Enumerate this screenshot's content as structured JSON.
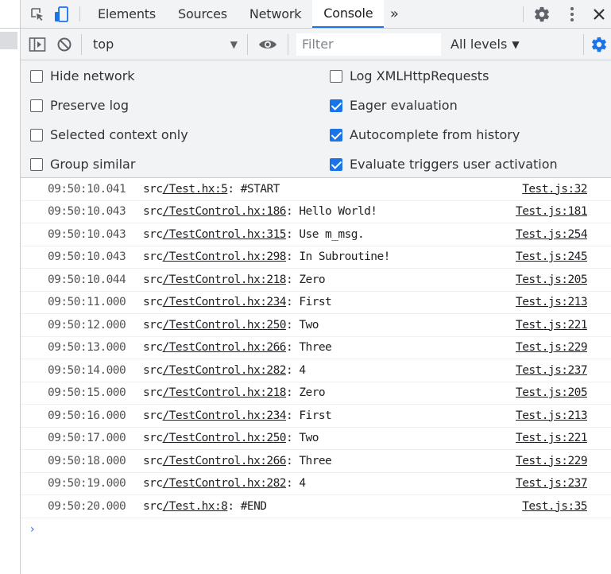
{
  "tabs": [
    {
      "label": "Elements"
    },
    {
      "label": "Sources"
    },
    {
      "label": "Network"
    },
    {
      "label": "Console",
      "active": true
    }
  ],
  "toolbar": {
    "context": "top",
    "filter_placeholder": "Filter",
    "levels_label": "All levels"
  },
  "settings": {
    "left": [
      {
        "label": "Hide network",
        "checked": false
      },
      {
        "label": "Preserve log",
        "checked": false
      },
      {
        "label": "Selected context only",
        "checked": false
      },
      {
        "label": "Group similar",
        "checked": false
      }
    ],
    "right": [
      {
        "label": "Log XMLHttpRequests",
        "checked": false
      },
      {
        "label": "Eager evaluation",
        "checked": true
      },
      {
        "label": "Autocomplete from history",
        "checked": true
      },
      {
        "label": "Evaluate triggers user activation",
        "checked": true
      }
    ]
  },
  "logs": [
    {
      "time": "09:50:10.041",
      "prefix": "src",
      "file": "/Test.hx:5",
      "text": ": #START",
      "source": "Test.js:32"
    },
    {
      "time": "09:50:10.043",
      "prefix": "src",
      "file": "/TestControl.hx:186",
      "text": ": Hello World!",
      "source": "Test.js:181"
    },
    {
      "time": "09:50:10.043",
      "prefix": "src",
      "file": "/TestControl.hx:315",
      "text": ": Use m_msg.",
      "source": "Test.js:254"
    },
    {
      "time": "09:50:10.043",
      "prefix": "src",
      "file": "/TestControl.hx:298",
      "text": ": In Subroutine!",
      "source": "Test.js:245"
    },
    {
      "time": "09:50:10.044",
      "prefix": "src",
      "file": "/TestControl.hx:218",
      "text": ": Zero",
      "source": "Test.js:205"
    },
    {
      "time": "09:50:11.000",
      "prefix": "src",
      "file": "/TestControl.hx:234",
      "text": ": First",
      "source": "Test.js:213"
    },
    {
      "time": "09:50:12.000",
      "prefix": "src",
      "file": "/TestControl.hx:250",
      "text": ": Two",
      "source": "Test.js:221"
    },
    {
      "time": "09:50:13.000",
      "prefix": "src",
      "file": "/TestControl.hx:266",
      "text": ": Three",
      "source": "Test.js:229"
    },
    {
      "time": "09:50:14.000",
      "prefix": "src",
      "file": "/TestControl.hx:282",
      "text": ": 4",
      "source": "Test.js:237"
    },
    {
      "time": "09:50:15.000",
      "prefix": "src",
      "file": "/TestControl.hx:218",
      "text": ": Zero",
      "source": "Test.js:205"
    },
    {
      "time": "09:50:16.000",
      "prefix": "src",
      "file": "/TestControl.hx:234",
      "text": ": First",
      "source": "Test.js:213"
    },
    {
      "time": "09:50:17.000",
      "prefix": "src",
      "file": "/TestControl.hx:250",
      "text": ": Two",
      "source": "Test.js:221"
    },
    {
      "time": "09:50:18.000",
      "prefix": "src",
      "file": "/TestControl.hx:266",
      "text": ": Three",
      "source": "Test.js:229"
    },
    {
      "time": "09:50:19.000",
      "prefix": "src",
      "file": "/TestControl.hx:282",
      "text": ": 4",
      "source": "Test.js:237"
    },
    {
      "time": "09:50:20.000",
      "prefix": "src",
      "file": "/Test.hx:8",
      "text": ": #END",
      "source": "Test.js:35"
    }
  ],
  "prompt_symbol": "›",
  "colors": {
    "accent": "#1a73e8",
    "toolbar_bg": "#f1f3f4",
    "border": "#cacdd1"
  }
}
